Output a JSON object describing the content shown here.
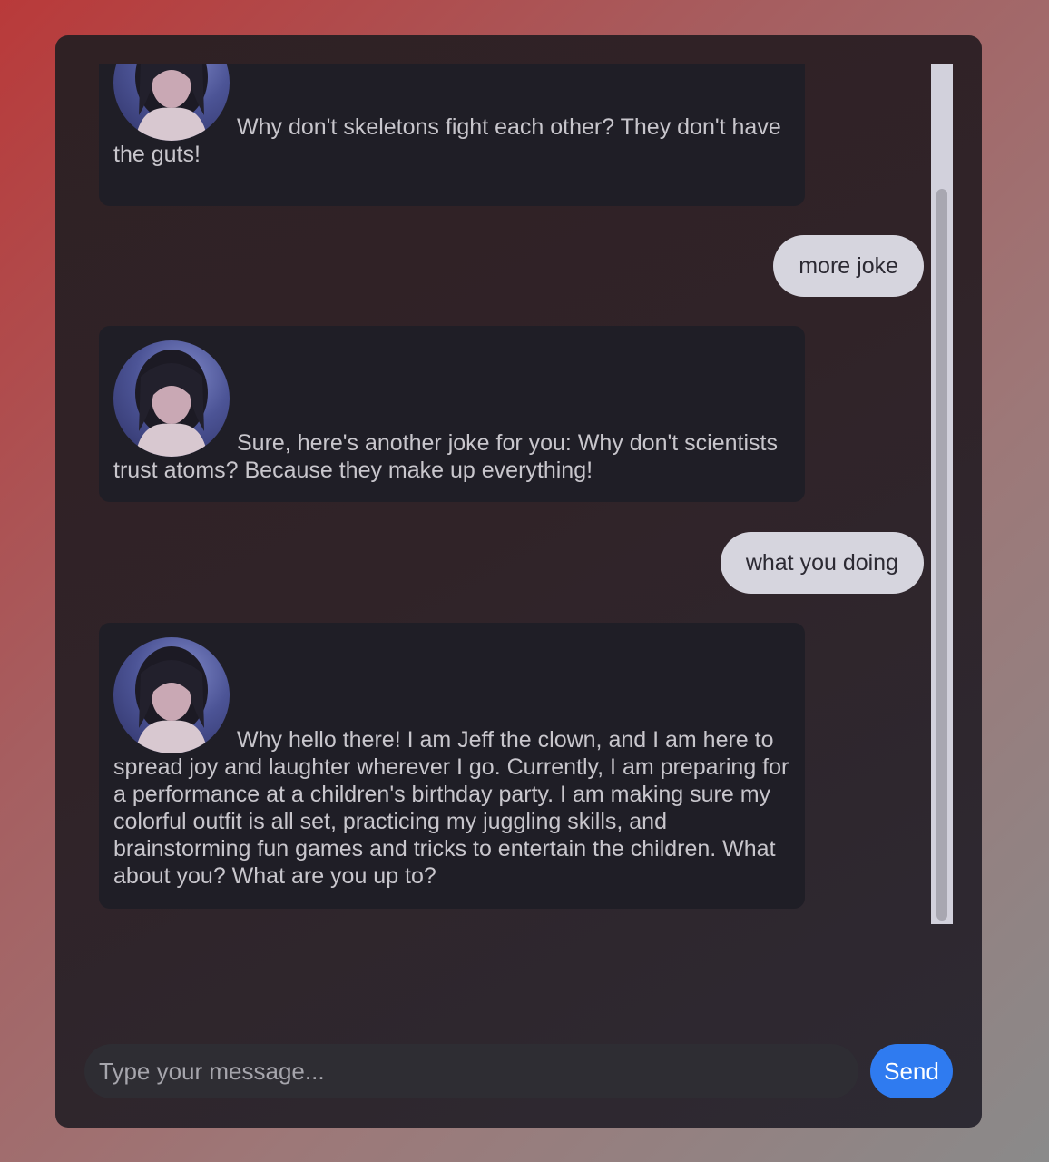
{
  "chat": {
    "messages": [
      {
        "role": "bot",
        "text": "Why don't skeletons fight each other? They don't have the guts!"
      },
      {
        "role": "user",
        "text": "more joke"
      },
      {
        "role": "bot",
        "text": "Sure, here's another joke for you: Why don't scientists trust atoms? Because they make up everything!"
      },
      {
        "role": "user",
        "text": "what you doing"
      },
      {
        "role": "bot",
        "text": "Why hello there! I am Jeff the clown, and I am here to spread joy and laughter wherever I go. Currently, I am preparing for a performance at a children's birthday party. I am making sure my colorful outfit is all set, practicing my juggling skills, and brainstorming fun games and tricks to entertain the children. What about you? What are you up to?"
      }
    ],
    "avatar_icon": "bot-avatar-portrait"
  },
  "composer": {
    "placeholder": "Type your message...",
    "value": "",
    "send_label": "Send"
  },
  "colors": {
    "send_button": "#2f7bf0",
    "user_bubble": "#d6d5de",
    "bot_bubble": "#1f1e26"
  }
}
